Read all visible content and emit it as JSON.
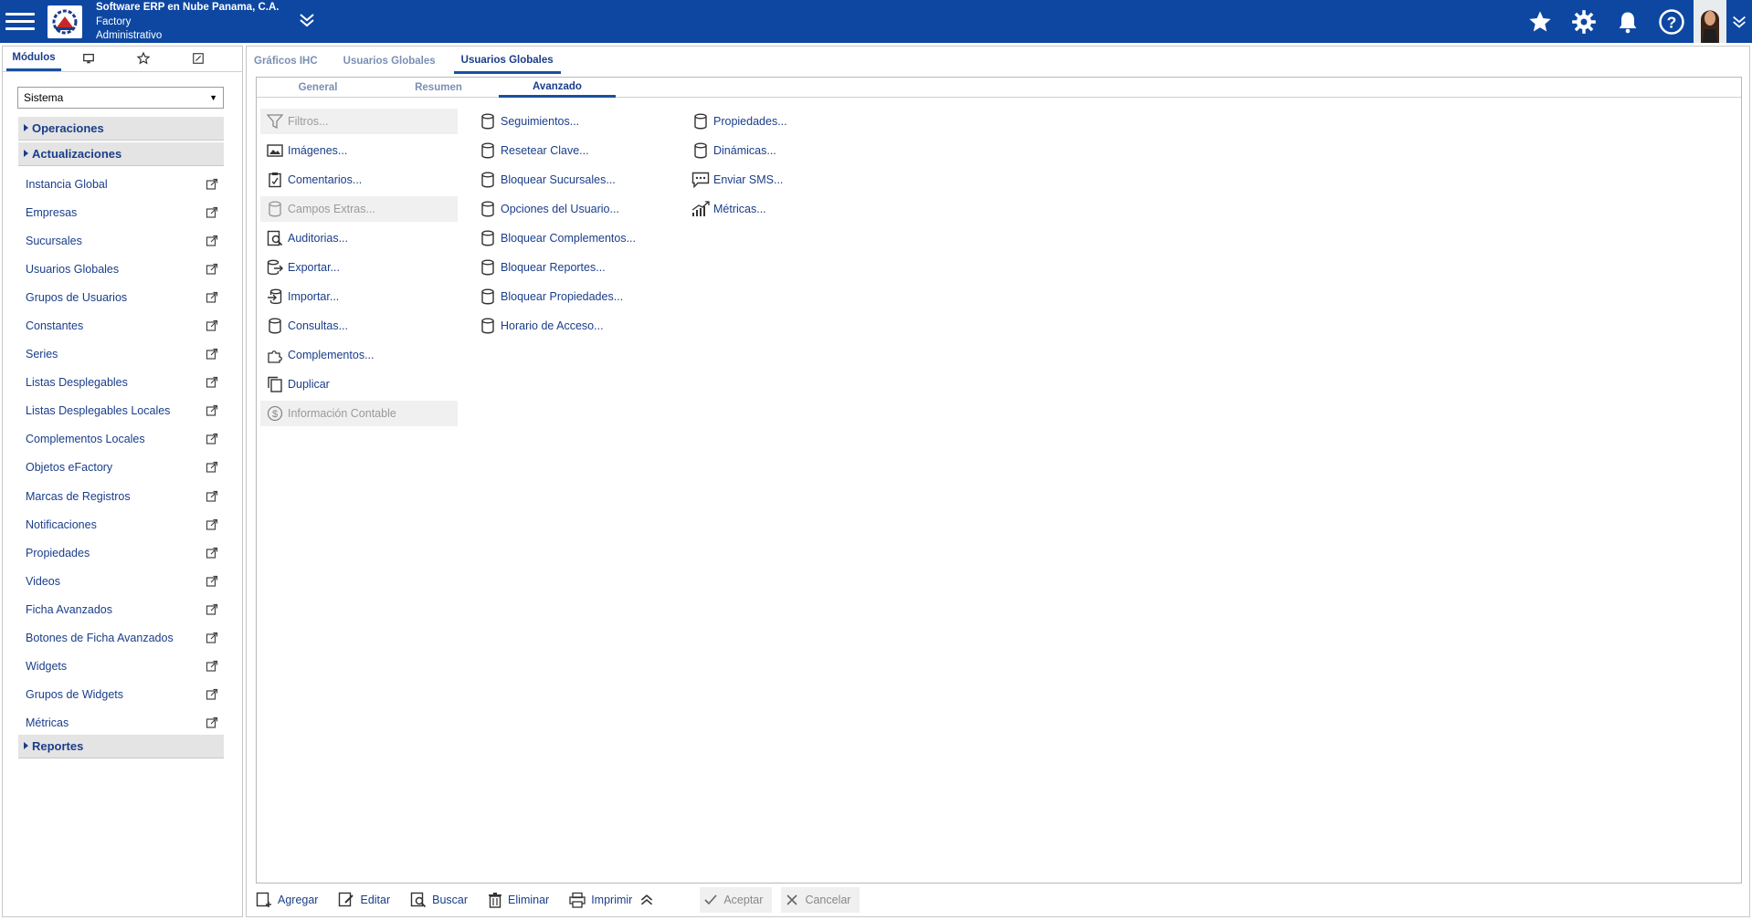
{
  "header": {
    "company": "Software ERP en Nube Panama, C.A.",
    "product": "Factory",
    "role": "Administrativo",
    "color": "#0d47a1"
  },
  "left": {
    "tabs": [
      "Módulos"
    ],
    "select_value": "Sistema",
    "groups": [
      "Operaciones",
      "Actualizaciones",
      "Reportes"
    ],
    "items": [
      "Instancia Global",
      "Empresas",
      "Sucursales",
      "Usuarios Globales",
      "Grupos de Usuarios",
      "Constantes",
      "Series",
      "Listas Desplegables",
      "Listas Desplegables Locales",
      "Complementos Locales",
      "Objetos eFactory",
      "Marcas de Registros",
      "Notificaciones",
      "Propiedades",
      "Videos",
      "Ficha Avanzados",
      "Botones de Ficha Avanzados",
      "Widgets",
      "Grupos de Widgets",
      "Métricas"
    ]
  },
  "main": {
    "tabs": [
      "Gráficos IHC",
      "Usuarios Globales",
      "Usuarios Globales"
    ],
    "subtabs": [
      "General",
      "Resumen",
      "Avanzado"
    ],
    "col1": [
      "Filtros...",
      "Imágenes...",
      "Comentarios...",
      "Campos Extras...",
      "Auditorias...",
      "Exportar...",
      "Importar...",
      "Consultas...",
      "Complementos...",
      "Duplicar",
      "Información Contable"
    ],
    "col2": [
      "Seguimientos...",
      "Resetear Clave...",
      "Bloquear Sucursales...",
      "Opciones del Usuario...",
      "Bloquear Complementos...",
      "Bloquear Reportes...",
      "Bloquear Propiedades...",
      "Horario de Acceso..."
    ],
    "col3": [
      "Propiedades...",
      "Dinámicas...",
      "Enviar SMS...",
      "Métricas..."
    ]
  },
  "toolbar": {
    "add": "Agregar",
    "edit": "Editar",
    "search": "Buscar",
    "delete": "Eliminar",
    "print": "Imprimir",
    "accept": "Aceptar",
    "cancel": "Cancelar"
  }
}
